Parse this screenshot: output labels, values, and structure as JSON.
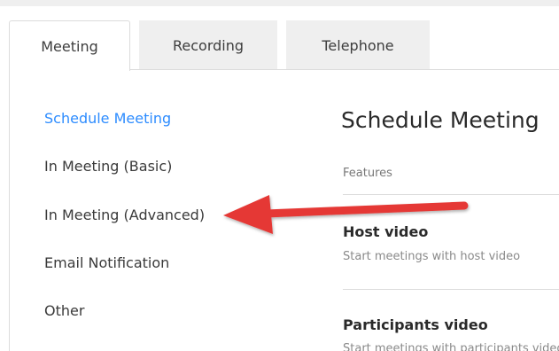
{
  "tabs": [
    {
      "label": "Meeting",
      "active": true
    },
    {
      "label": "Recording",
      "active": false
    },
    {
      "label": "Telephone",
      "active": false
    }
  ],
  "sidebar": {
    "items": [
      {
        "label": "Schedule Meeting",
        "active": true
      },
      {
        "label": "In Meeting (Basic)",
        "active": false
      },
      {
        "label": "In Meeting (Advanced)",
        "active": false
      },
      {
        "label": "Email Notification",
        "active": false
      },
      {
        "label": "Other",
        "active": false
      }
    ]
  },
  "content": {
    "title": "Schedule Meeting",
    "section_label": "Features",
    "settings": [
      {
        "title": "Host video",
        "description": "Start meetings with host video"
      },
      {
        "title": "Participants video",
        "description": "Start meetings with participants video"
      }
    ]
  },
  "annotation": {
    "arrow_color": "#e53935",
    "points_to": "In Meeting (Advanced)"
  },
  "colors": {
    "accent": "#2d8cff",
    "tab_inactive_bg": "#efefef",
    "border": "#dcdcdc"
  }
}
